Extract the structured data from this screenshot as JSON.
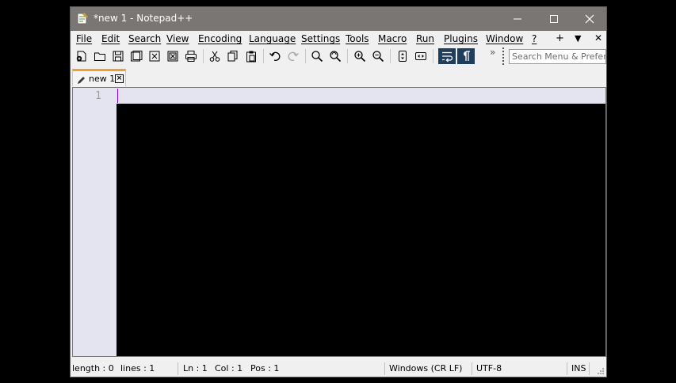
{
  "window": {
    "title": "*new 1 - Notepad++"
  },
  "menu": {
    "items": [
      "File",
      "Edit",
      "Search",
      "View",
      "Encoding",
      "Language",
      "Settings",
      "Tools",
      "Macro",
      "Run",
      "Plugins",
      "Window",
      "?"
    ],
    "right_controls": [
      "+",
      "▼",
      "✕"
    ]
  },
  "toolbar": {
    "search_placeholder": "Search Menu & Preferences",
    "overflow": "»"
  },
  "tabs": [
    {
      "label": "new 1",
      "modified": true
    }
  ],
  "editor": {
    "line_numbers": [
      "1"
    ]
  },
  "status": {
    "length": "length : 0",
    "lines": "lines : 1",
    "ln": "Ln : 1",
    "col": "Col : 1",
    "pos": "Pos : 1",
    "eol": "Windows (CR LF)",
    "encoding": "UTF-8",
    "mode": "INS"
  },
  "colors": {
    "titlebar": "#7a7674",
    "tab_accent": "#f0a030",
    "gutter": "#e4e4f0",
    "caret": "#8000ff",
    "active_toggle": "#1f3d5c"
  }
}
